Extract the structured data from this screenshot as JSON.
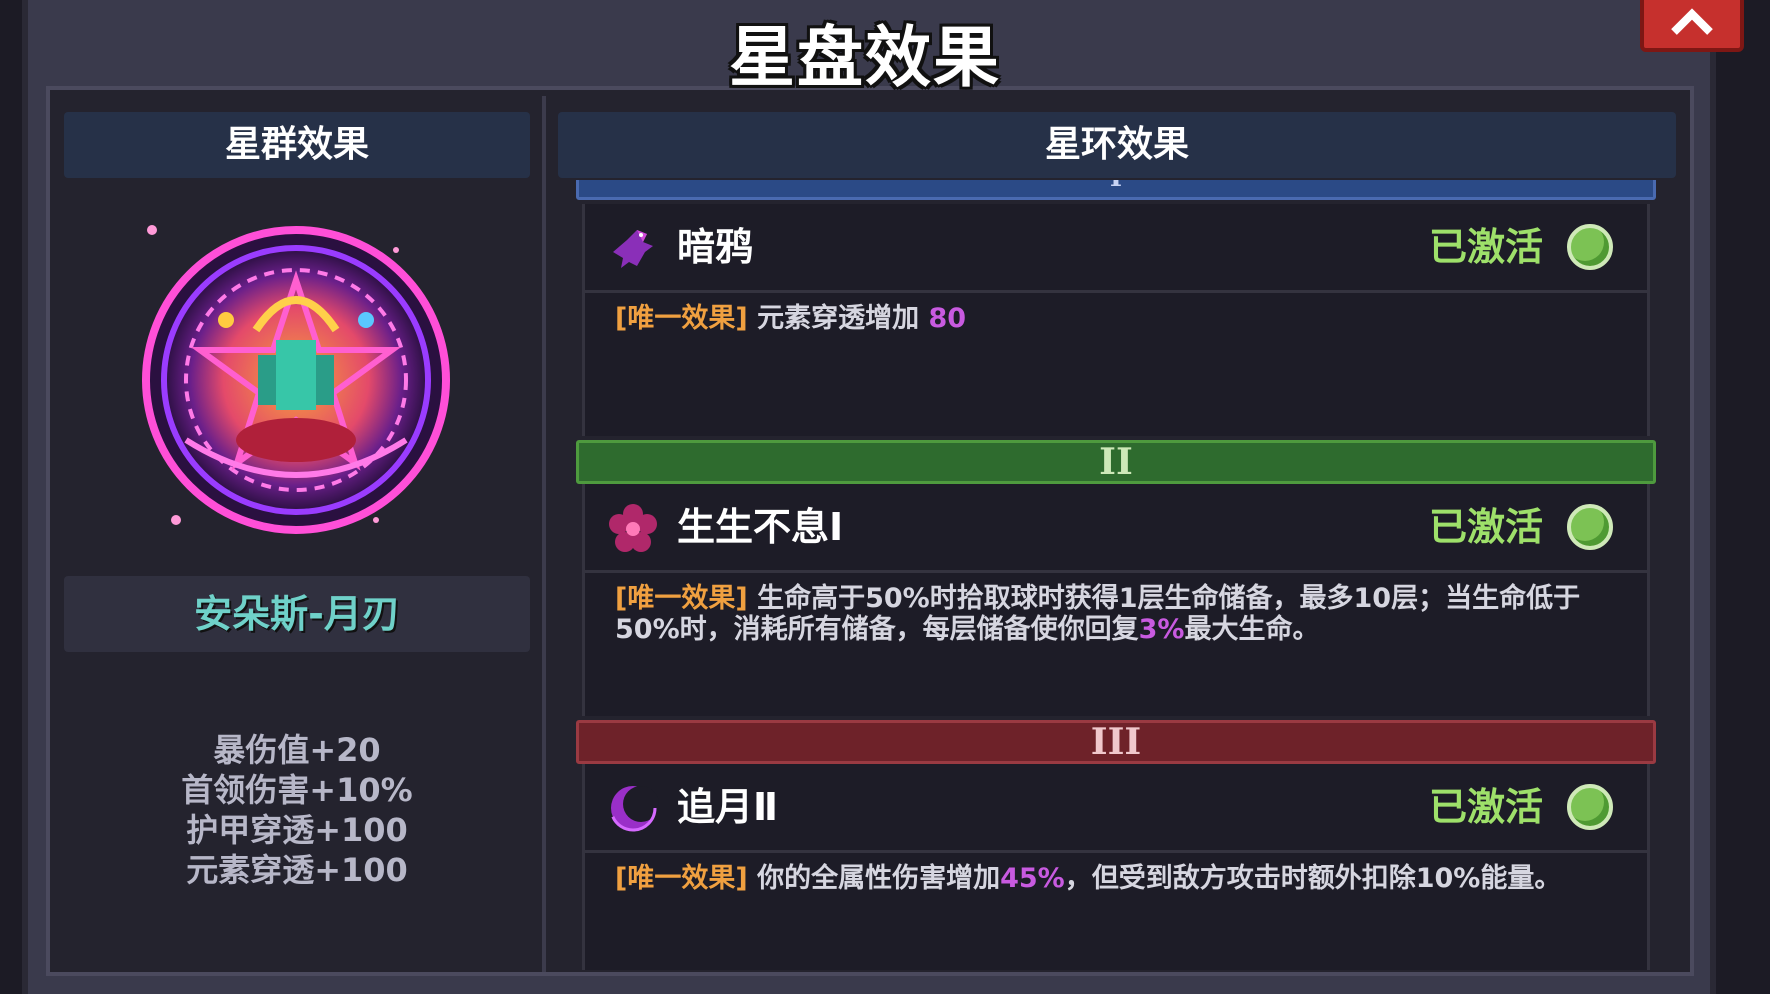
{
  "title": "星盘效果",
  "close_icon": "close-icon",
  "left_panel": {
    "header": "星群效果",
    "constellation_name": "安朵斯-月刃",
    "emblem_icon": "constellation-emblem-icon",
    "stats": [
      "暴伤值+20",
      "首领伤害+10%",
      "护甲穿透+100",
      "元素穿透+100"
    ]
  },
  "right_panel": {
    "header": "星环效果",
    "tiers": [
      {
        "numeral": "I",
        "color": "#2b4a86",
        "effect": {
          "icon": "crow-icon",
          "name": "暗鸦",
          "status": "已激活",
          "tag": "[唯一效果]",
          "desc_parts": [
            "元素穿透增加 ",
            "80",
            ""
          ]
        }
      },
      {
        "numeral": "II",
        "color": "#2e6b2e",
        "effect": {
          "icon": "flower-icon",
          "name": "生生不息Ⅰ",
          "status": "已激活",
          "tag": "[唯一效果]",
          "desc_parts": [
            "生命高于50%时拾取球时获得1层生命储备，最多10层；当生命低于50%时，消耗所有储备，每层储备使你回复",
            "3%",
            "最大生命。"
          ]
        }
      },
      {
        "numeral": "III",
        "color": "#6e2229",
        "effect": {
          "icon": "crescent-moon-icon",
          "name": "追月Ⅱ",
          "status": "已激活",
          "tag": "[唯一效果]",
          "desc_parts": [
            "你的全属性伤害增加",
            "45%",
            "，但受到敌方攻击时额外扣除10%能量。"
          ]
        }
      }
    ]
  },
  "colors": {
    "active_green": "#9ee06a",
    "tag_orange": "#f0a040",
    "highlight_purple": "#c85ae0",
    "name_teal": "#6fd1c9"
  }
}
